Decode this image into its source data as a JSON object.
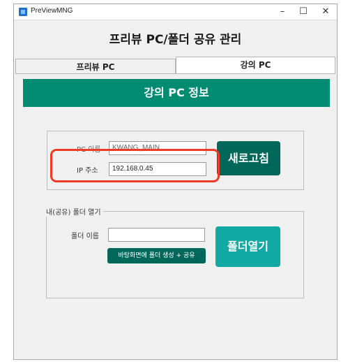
{
  "window": {
    "title": "PreViewMNG",
    "controls": {
      "minimize": "–",
      "maximize": "☐",
      "close": "✕"
    }
  },
  "main_title": "프리뷰 PC/폴더 공유 관리",
  "tabs": [
    {
      "label": "프리뷰 PC",
      "active": false
    },
    {
      "label": "강의 PC",
      "active": true
    }
  ],
  "header": {
    "text": "강의 PC 정보"
  },
  "pc_info": {
    "pc_name_label": "PC 이름",
    "pc_name_value": "KWANG_MAIN",
    "ip_label": "IP 주소",
    "ip_value": "192.168.0.45",
    "refresh_button": "새로고침"
  },
  "folder_group": {
    "legend": "내(공유) 폴더 열기",
    "folder_name_label": "폴더 이름",
    "folder_name_value": "",
    "create_share_button": "바탕화면에 폴더 생성 + 공유",
    "open_folder_button": "폴더열기"
  },
  "colors": {
    "header_bg": "#008c72",
    "refresh_button_bg": "#00685a",
    "open_button_bg": "#12a8a4",
    "highlight": "#ef3b23"
  }
}
